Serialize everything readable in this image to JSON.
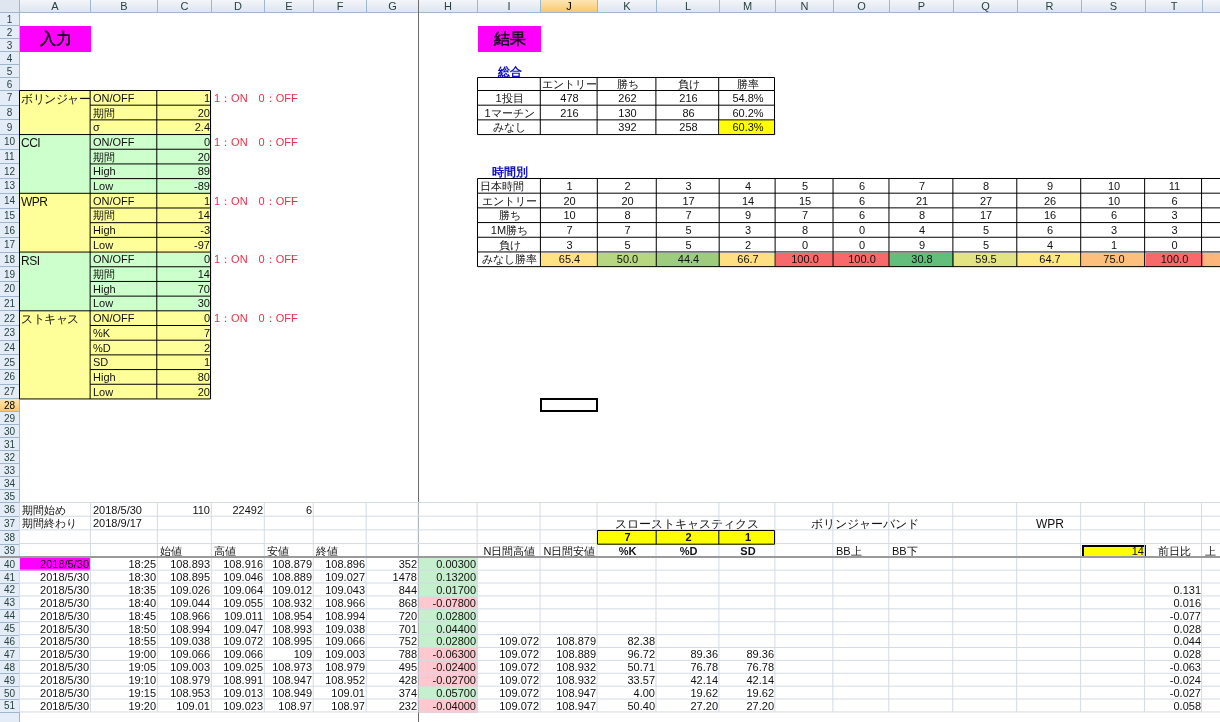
{
  "columns": [
    {
      "letter": "A",
      "selected": false
    },
    {
      "letter": "B",
      "selected": false
    },
    {
      "letter": "C",
      "selected": false
    },
    {
      "letter": "D",
      "selected": false
    },
    {
      "letter": "E",
      "selected": false
    },
    {
      "letter": "F",
      "selected": false
    },
    {
      "letter": "G",
      "selected": false
    },
    {
      "letter": "H",
      "selected": false
    },
    {
      "letter": "I",
      "selected": false
    },
    {
      "letter": "J",
      "selected": true
    },
    {
      "letter": "K",
      "selected": false
    },
    {
      "letter": "L",
      "selected": false
    },
    {
      "letter": "M",
      "selected": false
    },
    {
      "letter": "N",
      "selected": false
    },
    {
      "letter": "O",
      "selected": false
    },
    {
      "letter": "P",
      "selected": false
    },
    {
      "letter": "Q",
      "selected": false
    },
    {
      "letter": "R",
      "selected": false
    },
    {
      "letter": "S",
      "selected": false
    },
    {
      "letter": "T",
      "selected": false
    }
  ],
  "row_numbers": [
    {
      "number": "1",
      "selected": false
    },
    {
      "number": "2",
      "selected": false
    },
    {
      "number": "3",
      "selected": false
    },
    {
      "number": "4",
      "selected": false
    },
    {
      "number": "5",
      "selected": false
    },
    {
      "number": "6",
      "selected": false
    },
    {
      "number": "7",
      "selected": false
    },
    {
      "number": "8",
      "selected": false
    },
    {
      "number": "9",
      "selected": false
    },
    {
      "number": "10",
      "selected": false
    },
    {
      "number": "11",
      "selected": false
    },
    {
      "number": "12",
      "selected": false
    },
    {
      "number": "13",
      "selected": false
    },
    {
      "number": "14",
      "selected": false
    },
    {
      "number": "15",
      "selected": false
    },
    {
      "number": "16",
      "selected": false
    },
    {
      "number": "17",
      "selected": false
    },
    {
      "number": "18",
      "selected": false
    },
    {
      "number": "19",
      "selected": false
    },
    {
      "number": "20",
      "selected": false
    },
    {
      "number": "21",
      "selected": false
    },
    {
      "number": "22",
      "selected": false
    },
    {
      "number": "23",
      "selected": false
    },
    {
      "number": "24",
      "selected": false
    },
    {
      "number": "25",
      "selected": false
    },
    {
      "number": "26",
      "selected": false
    },
    {
      "number": "27",
      "selected": false
    },
    {
      "number": "28",
      "selected": true
    },
    {
      "number": "29",
      "selected": false
    },
    {
      "number": "30",
      "selected": false
    },
    {
      "number": "31",
      "selected": false
    },
    {
      "number": "32",
      "selected": false
    },
    {
      "number": "33",
      "selected": false
    },
    {
      "number": "34",
      "selected": false
    },
    {
      "number": "35",
      "selected": false
    },
    {
      "number": "36",
      "selected": false
    },
    {
      "number": "37",
      "selected": false
    },
    {
      "number": "38",
      "selected": false
    },
    {
      "number": "39",
      "selected": false
    },
    {
      "number": "40",
      "selected": false
    },
    {
      "number": "41",
      "selected": false
    },
    {
      "number": "42",
      "selected": false
    },
    {
      "number": "43",
      "selected": false
    },
    {
      "number": "44",
      "selected": false
    },
    {
      "number": "45",
      "selected": false
    },
    {
      "number": "46",
      "selected": false
    },
    {
      "number": "47",
      "selected": false
    },
    {
      "number": "48",
      "selected": false
    },
    {
      "number": "49",
      "selected": false
    },
    {
      "number": "50",
      "selected": false
    },
    {
      "number": "51",
      "selected": false
    }
  ],
  "input": {
    "title": "入力",
    "groups": [
      {
        "name": "ボリンジャー",
        "color": "#ffff99",
        "note": "1：ON　0：OFF",
        "params": [
          {
            "label": "ON/OFF",
            "value": "1"
          },
          {
            "label": "期間",
            "value": "20"
          },
          {
            "label": "σ",
            "value": "2.4"
          }
        ]
      },
      {
        "name": "CCI",
        "color": "#ccffcc",
        "note": "1：ON　0：OFF",
        "params": [
          {
            "label": "ON/OFF",
            "value": "0"
          },
          {
            "label": "期間",
            "value": "20"
          },
          {
            "label": "High",
            "value": "89"
          },
          {
            "label": "Low",
            "value": "-89"
          }
        ]
      },
      {
        "name": "WPR",
        "color": "#ffff99",
        "note": "1：ON　0：OFF",
        "params": [
          {
            "label": "ON/OFF",
            "value": "1"
          },
          {
            "label": "期間",
            "value": "14"
          },
          {
            "label": "High",
            "value": "-3"
          },
          {
            "label": "Low",
            "value": "-97"
          }
        ]
      },
      {
        "name": "RSI",
        "color": "#ccffcc",
        "note": "1：ON　0：OFF",
        "params": [
          {
            "label": "ON/OFF",
            "value": "0"
          },
          {
            "label": "期間",
            "value": "14"
          },
          {
            "label": "High",
            "value": "70"
          },
          {
            "label": "Low",
            "value": "30"
          }
        ]
      },
      {
        "name": "ストキャス",
        "color": "#ffff99",
        "note": "1：ON　0：OFF",
        "params": [
          {
            "label": "ON/OFF",
            "value": "0"
          },
          {
            "label": "%K",
            "value": "7"
          },
          {
            "label": "%D",
            "value": "2"
          },
          {
            "label": "SD",
            "value": "1"
          },
          {
            "label": "High",
            "value": "80"
          },
          {
            "label": "Low",
            "value": "20"
          }
        ]
      }
    ]
  },
  "result": {
    "title": "結果"
  },
  "summary": {
    "heading": "総合",
    "columns": [
      "エントリー",
      "勝ち",
      "負け",
      "勝率"
    ],
    "rows": [
      {
        "label": "1投目",
        "values": [
          "478",
          "262",
          "216",
          "54.8%"
        ],
        "highlighted": false
      },
      {
        "label": "1マーチン",
        "values": [
          "216",
          "130",
          "86",
          "60.2%"
        ],
        "highlighted": false
      },
      {
        "label": "みなし",
        "values": [
          "392",
          "258",
          "60.3%"
        ],
        "highlighted": true
      }
    ]
  },
  "hourly": {
    "heading": "時間別",
    "rows": [
      {
        "label": "日本時間",
        "values": [
          "1",
          "2",
          "3",
          "4",
          "5",
          "6",
          "7",
          "8",
          "9",
          "10",
          "11"
        ]
      },
      {
        "label": "エントリー",
        "values": [
          "20",
          "20",
          "17",
          "14",
          "15",
          "6",
          "21",
          "27",
          "26",
          "10",
          "6"
        ]
      },
      {
        "label": "勝ち",
        "values": [
          "10",
          "8",
          "7",
          "9",
          "7",
          "6",
          "8",
          "17",
          "16",
          "6",
          "3"
        ]
      },
      {
        "label": "1M勝ち",
        "values": [
          "7",
          "7",
          "5",
          "3",
          "8",
          "0",
          "4",
          "5",
          "6",
          "3",
          "3"
        ]
      },
      {
        "label": "負け",
        "values": [
          "3",
          "5",
          "5",
          "2",
          "0",
          "0",
          "9",
          "5",
          "4",
          "1",
          "0"
        ]
      }
    ],
    "rate_row": {
      "label": "みなし勝率",
      "cells": [
        {
          "text": "65.4",
          "color": "#fee283"
        },
        {
          "text": "50.0",
          "color": "#b6d780"
        },
        {
          "text": "44.4",
          "color": "#9dcc7d"
        },
        {
          "text": "66.7",
          "color": "#fedf82"
        },
        {
          "text": "100.0",
          "color": "#f8696b"
        },
        {
          "text": "100.0",
          "color": "#f8696b"
        },
        {
          "text": "30.8",
          "color": "#63be7b"
        },
        {
          "text": "59.5",
          "color": "#e2e383"
        },
        {
          "text": "64.7",
          "color": "#fde984"
        },
        {
          "text": "75.0",
          "color": "#fdc07c"
        },
        {
          "text": "100.0",
          "color": "#f8696b"
        },
        {
          "color": "#fcb679"
        }
      ]
    }
  },
  "period": {
    "start": {
      "label": "期間始め",
      "date": "2018/5/30",
      "values": [
        "110",
        "22492",
        "6"
      ]
    },
    "end": {
      "label": "期間終わり",
      "date": "2018/9/17"
    }
  },
  "indicator_groups": [
    "スローストキャスティクス",
    "ボリンジャーバンド",
    "WPR"
  ],
  "stochastic_settings": [
    "7",
    "2",
    "1"
  ],
  "data_headers": [
    "始値",
    "高値",
    "安値",
    "終値",
    "N日間高値",
    "N日間安値",
    "%K",
    "%D",
    "SD",
    "BB上",
    "BB下",
    "前日比",
    "上"
  ],
  "wpr_period": "14",
  "data_rows": [
    {
      "date": "2018/5/30",
      "highlighted": true,
      "time": "18:25",
      "open": "108.893",
      "high": "108.916",
      "low": "108.879",
      "close": "108.896",
      "volume": "352",
      "change": "0.00300",
      "color": "#c6efce"
    },
    {
      "date": "2018/5/30",
      "highlighted": false,
      "time": "18:30",
      "open": "108.895",
      "high": "109.046",
      "low": "108.889",
      "close": "109.027",
      "volume": "1478",
      "change": "0.13200",
      "color": "#c6efce"
    },
    {
      "date": "2018/5/30",
      "highlighted": false,
      "time": "18:35",
      "open": "109.026",
      "high": "109.064",
      "low": "109.012",
      "close": "109.043",
      "volume": "844",
      "change": "0.01700",
      "color": "#c6efce",
      "day_change": "0.131"
    },
    {
      "date": "2018/5/30",
      "highlighted": false,
      "time": "18:40",
      "open": "109.044",
      "high": "109.055",
      "low": "108.932",
      "close": "108.966",
      "volume": "868",
      "change": "-0.07800",
      "color": "#ffc7ce",
      "day_change": "0.016"
    },
    {
      "date": "2018/5/30",
      "highlighted": false,
      "time": "18:45",
      "open": "108.966",
      "high": "109.011",
      "low": "108.954",
      "close": "108.994",
      "volume": "720",
      "change": "0.02800",
      "color": "#c6efce",
      "day_change": "-0.077"
    },
    {
      "date": "2018/5/30",
      "highlighted": false,
      "time": "18:50",
      "open": "108.994",
      "high": "109.047",
      "low": "108.993",
      "close": "109.038",
      "volume": "701",
      "change": "0.04400",
      "color": "#c6efce",
      "day_change": "0.028"
    },
    {
      "date": "2018/5/30",
      "highlighted": false,
      "time": "18:55",
      "open": "109.038",
      "high": "109.072",
      "low": "108.995",
      "close": "109.066",
      "volume": "752",
      "change": "0.02800",
      "color": "#c6efce",
      "n_high": "109.072",
      "n_low": "108.879",
      "pct_k": "82.38",
      "day_change": "0.044"
    },
    {
      "date": "2018/5/30",
      "highlighted": false,
      "time": "19:00",
      "open": "109.066",
      "high": "109.066",
      "low": "109",
      "close": "109.003",
      "volume": "788",
      "change": "-0.06300",
      "color": "#ffc7ce",
      "n_high": "109.072",
      "n_low": "108.889",
      "pct_k": "96.72",
      "pct_d": "89.36",
      "sd": "89.36",
      "day_change": "0.028"
    },
    {
      "date": "2018/5/30",
      "highlighted": false,
      "time": "19:05",
      "open": "109.003",
      "high": "109.025",
      "low": "108.973",
      "close": "108.979",
      "volume": "495",
      "change": "-0.02400",
      "color": "#ffc7ce",
      "n_high": "109.072",
      "n_low": "108.932",
      "pct_k": "50.71",
      "pct_d": "76.78",
      "sd": "76.78",
      "day_change": "-0.063"
    },
    {
      "date": "2018/5/30",
      "highlighted": false,
      "time": "19:10",
      "open": "108.979",
      "high": "108.991",
      "low": "108.947",
      "close": "108.952",
      "volume": "428",
      "change": "-0.02700",
      "color": "#ffc7ce",
      "n_high": "109.072",
      "n_low": "108.932",
      "pct_k": "33.57",
      "pct_d": "42.14",
      "sd": "42.14",
      "day_change": "-0.024"
    },
    {
      "date": "2018/5/30",
      "highlighted": false,
      "time": "19:15",
      "open": "108.953",
      "high": "109.013",
      "low": "108.949",
      "close": "109.01",
      "volume": "374",
      "change": "0.05700",
      "color": "#c6efce",
      "n_high": "109.072",
      "n_low": "108.947",
      "pct_k": "4.00",
      "pct_d": "19.62",
      "sd": "19.62",
      "day_change": "-0.027"
    },
    {
      "date": "2018/5/30",
      "highlighted": false,
      "time": "19:20",
      "open": "109.01",
      "high": "109.023",
      "low": "108.97",
      "close": "108.97",
      "volume": "232",
      "change": "-0.04000",
      "color": "#ffc7ce",
      "n_high": "109.072",
      "n_low": "108.947",
      "pct_k": "50.40",
      "pct_d": "27.20",
      "sd": "27.20",
      "day_change": "0.058"
    }
  ]
}
